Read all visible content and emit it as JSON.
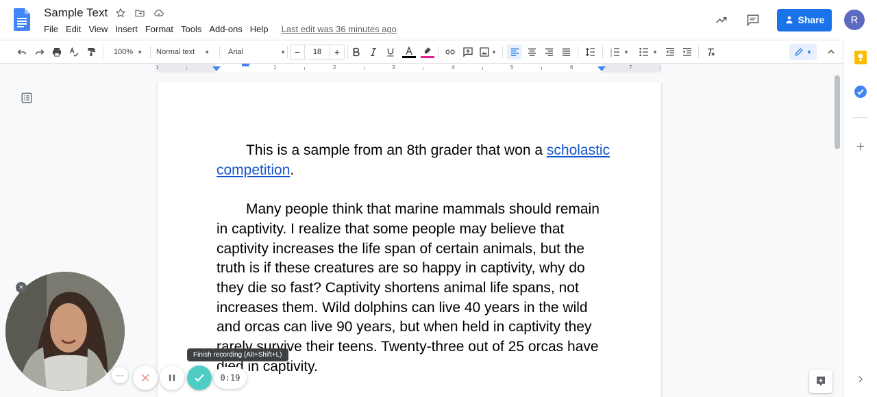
{
  "doc": {
    "title": "Sample Text",
    "last_edit": "Last edit was 36 minutes ago",
    "menu": [
      "File",
      "Edit",
      "View",
      "Insert",
      "Format",
      "Tools",
      "Add-ons",
      "Help"
    ]
  },
  "header": {
    "share_label": "Share",
    "avatar_initial": "R"
  },
  "toolbar": {
    "zoom": "100%",
    "style": "Normal text",
    "font": "Arial",
    "font_size": "18",
    "minus": "−",
    "plus": "+",
    "text_color": "#000000",
    "highlight_color": "#e91e8c"
  },
  "ruler": {
    "labels": [
      "1",
      "1",
      "2",
      "3",
      "4",
      "5",
      "6",
      "7"
    ]
  },
  "content": {
    "p1_text": "This is a sample from an 8th grader that won a ",
    "p1_link": "scholastic competition",
    "p1_end": ".",
    "p2": "Many people think that marine mammals should remain in captivity. I realize that some people may believe that captivity increases the life span of certain animals, but the truth is if these creatures are so happy in captivity, why do they die so fast? Captivity shortens animal life spans, not increases them. Wild dolphins can live 40 years in the wild and orcas can live 90 years, but when held in captivity they rarely survive their teens. Twenty-three out of 25 orcas have died in captivity."
  },
  "recorder": {
    "tooltip": "Finish recording (Alt+Shift+L)",
    "timer": "0:19",
    "more": "···",
    "close": "×"
  },
  "colors": {
    "accent": "#1a73e8",
    "finish": "#4ecdc4",
    "cancel": "#ea8a8a",
    "keep": "#fbbc04",
    "tasks": "#4285f4"
  }
}
